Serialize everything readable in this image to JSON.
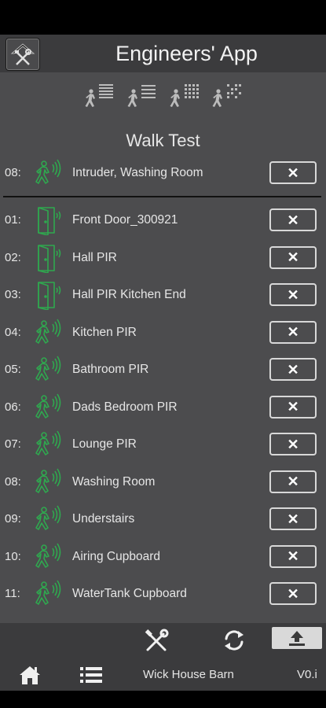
{
  "header": {
    "title": "Engineers' App",
    "logo_icon": "tools-house-icon"
  },
  "modes": [
    {
      "icon": "walk-test-list-icon"
    },
    {
      "icon": "walk-test-lines-icon"
    },
    {
      "icon": "walk-test-grid-icon"
    },
    {
      "icon": "walk-test-pattern-icon"
    }
  ],
  "section_title": "Walk Test",
  "current": {
    "num": "08:",
    "name": "Intruder, Washing Room",
    "type": "pir",
    "remove_label": "✕"
  },
  "devices": [
    {
      "num": "01:",
      "name": "Front Door_300921",
      "type": "door",
      "remove_label": "✕"
    },
    {
      "num": "02:",
      "name": "Hall PIR",
      "type": "door",
      "remove_label": "✕"
    },
    {
      "num": "03:",
      "name": "Hall PIR Kitchen End",
      "type": "door",
      "remove_label": "✕"
    },
    {
      "num": "04:",
      "name": "Kitchen PIR",
      "type": "pir",
      "remove_label": "✕"
    },
    {
      "num": "05:",
      "name": "Bathroom PIR",
      "type": "pir",
      "remove_label": "✕"
    },
    {
      "num": "06:",
      "name": "Dads Bedroom PIR",
      "type": "pir",
      "remove_label": "✕"
    },
    {
      "num": "07:",
      "name": "Lounge PIR",
      "type": "pir",
      "remove_label": "✕"
    },
    {
      "num": "08:",
      "name": "Washing Room",
      "type": "pir",
      "remove_label": "✕"
    },
    {
      "num": "09:",
      "name": "Understairs",
      "type": "pir",
      "remove_label": "✕"
    },
    {
      "num": "10:",
      "name": "Airing Cupboard",
      "type": "pir",
      "remove_label": "✕"
    },
    {
      "num": "11:",
      "name": "WaterTank Cupboard",
      "type": "pir",
      "remove_label": "✕"
    }
  ],
  "toolbar": {
    "tools_icon": "tools-icon",
    "sync_icon": "sync-icon",
    "upload_icon": "upload-icon"
  },
  "bottom": {
    "home_icon": "home-icon",
    "menu_icon": "list-menu-icon",
    "site_name": "Wick House Barn",
    "version": "V0.i"
  },
  "colors": {
    "accent_green": "#2fa84f",
    "header_bg": "#3b3b3d",
    "content_bg": "#4c4c4e"
  }
}
